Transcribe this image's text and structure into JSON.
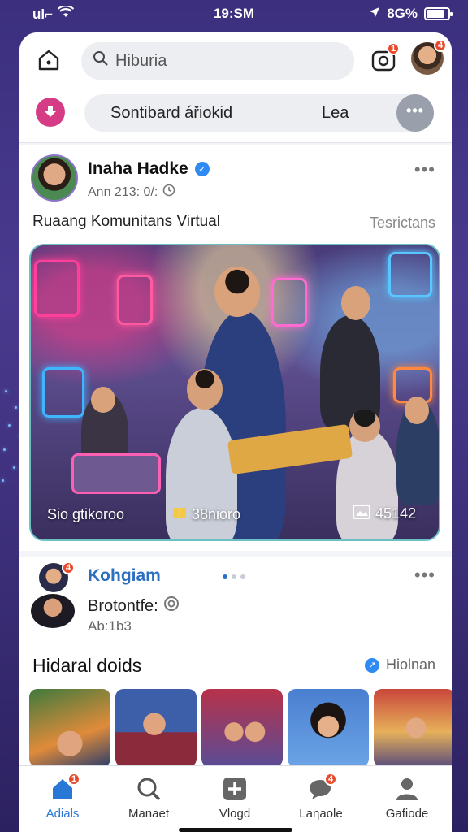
{
  "status_bar": {
    "carrier": "ul⌐",
    "time": "19:SM",
    "battery": "8G%",
    "battery_level": 0.85
  },
  "header": {
    "search_placeholder": "Hiburia",
    "notification_count": "1",
    "avatar_badge": "4"
  },
  "tabs": {
    "primary": "Sontibard ářiokid",
    "secondary": "Lea",
    "more": "•••"
  },
  "post": {
    "author": "Inaha Hadke",
    "timestamp": "Ann 213: 0/:",
    "caption": "Ruaang Komunitans Virtual",
    "caption_right": "Tesrictans",
    "stat_left": "Sio gtikoroo",
    "stat_middle": "38nioro",
    "stat_right": "45142"
  },
  "post2": {
    "name": "Kohgiam",
    "badge": "4",
    "subtitle": "Brotontfe:",
    "meta": "Ab:1b3"
  },
  "section": {
    "title": "Hidaral doids",
    "link": "Hiolnan"
  },
  "nav": {
    "items": [
      {
        "label": "Adials",
        "icon": "home-icon",
        "badge": "1"
      },
      {
        "label": "Manaet",
        "icon": "search-icon"
      },
      {
        "label": "Vlogd",
        "icon": "create-icon"
      },
      {
        "label": "Laηaole",
        "icon": "chat-icon",
        "badge": "4"
      },
      {
        "label": "Gafiode",
        "icon": "profile-icon"
      }
    ]
  },
  "colors": {
    "accent": "#2a78d6",
    "badge": "#e8492b",
    "background": "#3b2f7e"
  }
}
